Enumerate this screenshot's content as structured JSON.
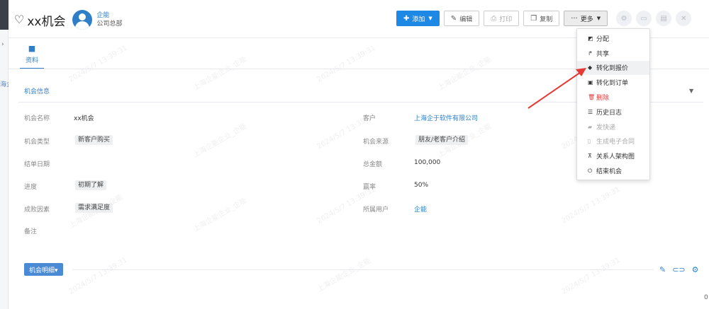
{
  "header": {
    "title": "xx机会",
    "owner_name": "企能",
    "owner_dept": "公司总部"
  },
  "toolbar": {
    "add_label": "添加",
    "edit_label": "编辑",
    "print_label": "打印",
    "copy_label": "复制",
    "more_label": "更多"
  },
  "tabs": [
    {
      "label": "资料"
    }
  ],
  "section": {
    "title": "机会信息"
  },
  "fields": {
    "name_label": "机会名称",
    "name_value": "xx机会",
    "type_label": "机会类型",
    "type_value": "新客户购买",
    "close_date_label": "结单日期",
    "progress_label": "进度",
    "progress_value": "初期了解",
    "factor_label": "成败因素",
    "factor_value": "需求满足度",
    "note_label": "备注",
    "customer_label": "客户",
    "customer_value": "上海企于软件有限公司",
    "source_label": "机会来源",
    "source_value": "朋友/老客户介绍",
    "amount_label": "总金额",
    "amount_value": "100,000",
    "rate_label": "赢率",
    "rate_value": "50%",
    "user_label": "所属用户",
    "user_value": "企能"
  },
  "detail": {
    "button_label": "机会明细▾"
  },
  "more_menu": {
    "items": [
      {
        "label": "分配",
        "icon": "assign-icon"
      },
      {
        "label": "共享",
        "icon": "share-icon"
      },
      {
        "label": "转化到报价",
        "icon": "quote-icon"
      },
      {
        "label": "转化到订单",
        "icon": "order-icon"
      },
      {
        "label": "删除",
        "icon": "trash-icon"
      },
      {
        "label": "历史日志",
        "icon": "list-icon"
      },
      {
        "label": "发快递",
        "icon": "truck-icon"
      },
      {
        "label": "生成电子合同",
        "icon": "document-icon"
      },
      {
        "label": "关系人架构图",
        "icon": "sitemap-icon"
      },
      {
        "label": "结束机会",
        "icon": "power-icon"
      }
    ]
  },
  "watermark": {
    "text_a": "2024/5/7 13:39:31",
    "text_b": "上海企能企业_企能"
  },
  "left_strip": {
    "text": "海企"
  },
  "colors": {
    "primary": "#1e88e5",
    "link": "#2f7fc8",
    "danger": "#e23a3a",
    "arrow": "#e53935"
  }
}
